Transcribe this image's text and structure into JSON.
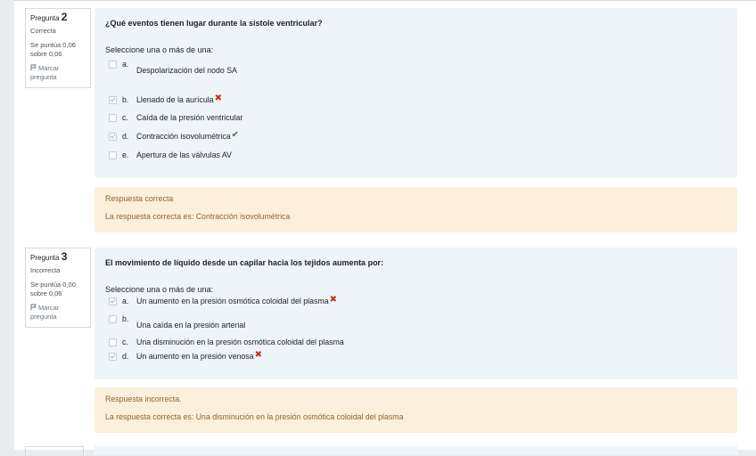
{
  "questions": [
    {
      "info": {
        "label": "Pregunta",
        "number": "2",
        "state": "Correcta",
        "grade": "Se puntúa 0,06 sobre 0,06",
        "flag": "Marcar pregunta"
      },
      "text": "¿Qué eventos tienen lugar durante la sístole ventricular?",
      "prompt": "Seleccione una o más de una:",
      "options": [
        {
          "letter": "a.",
          "text": "Despolarización del nodo SA",
          "checked": false,
          "mark": ""
        },
        {
          "letter": "b.",
          "text": "Llenado de la aurícula",
          "checked": true,
          "mark": "wrong"
        },
        {
          "letter": "c.",
          "text": "Caída de la presión ventricular",
          "checked": false,
          "mark": ""
        },
        {
          "letter": "d.",
          "text": "Contracción isovolumétrica",
          "checked": true,
          "mark": "right"
        },
        {
          "letter": "e.",
          "text": "Apertura de las válvulas AV",
          "checked": false,
          "mark": ""
        }
      ],
      "feedback": {
        "status": "Respuesta correcta",
        "answer": "La respuesta correcta es: Contracción isovolumétrica"
      }
    },
    {
      "info": {
        "label": "Pregunta",
        "number": "3",
        "state": "Incorrecta",
        "grade": "Se puntúa 0,00 sobre 0,06",
        "flag": "Marcar pregunta"
      },
      "text": "El movimiento de líquido desde un capilar hacia los tejidos aumenta por:",
      "prompt": "Seleccione una o más de una:",
      "options": [
        {
          "letter": "a.",
          "text": "Un aumento en la presión osmótica coloidal del plasma",
          "checked": true,
          "mark": "wrong"
        },
        {
          "letter": "b.",
          "text": "Una caída en la presión arterial",
          "checked": false,
          "mark": ""
        },
        {
          "letter": "c.",
          "text": "Una disminución en la presión osmótica coloidal del plasma",
          "checked": false,
          "mark": ""
        },
        {
          "letter": "d.",
          "text": "Un aumento en la presión venosa",
          "checked": true,
          "mark": "wrong"
        }
      ],
      "feedback": {
        "status": "Respuesta incorrecta.",
        "answer": "La respuesta correcta es: Una disminución en la presión osmótica coloidal del plasma"
      }
    }
  ],
  "icons": {
    "wrong_glyph": "✖",
    "right_glyph": "✔",
    "wrong_color": "#ca3120",
    "right_color": "#357a32",
    "flag": "flag-icon"
  }
}
